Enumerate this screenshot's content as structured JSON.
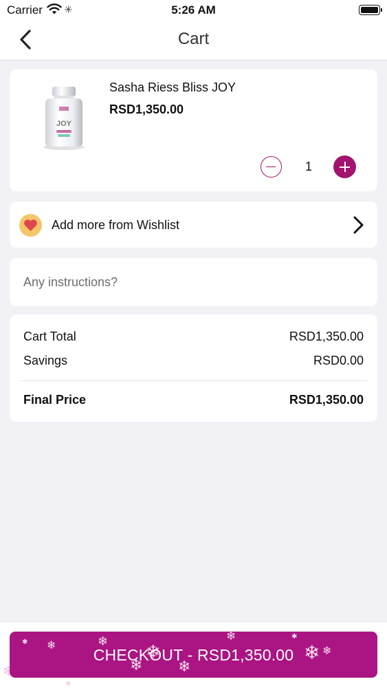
{
  "status_bar": {
    "carrier": "Carrier",
    "time": "5:26 AM",
    "icons": [
      "wifi-icon",
      "activity-spinner-icon",
      "battery-icon"
    ]
  },
  "navbar": {
    "title": "Cart",
    "back_icon": "chevron-left-icon"
  },
  "cart_item": {
    "name": "Sasha Riess Bliss JOY",
    "price": "RSD1,350.00",
    "quantity": "1",
    "image_label": "JOY"
  },
  "wishlist": {
    "label": "Add more from Wishlist",
    "icon": "heart-icon"
  },
  "instructions": {
    "placeholder": "Any instructions?",
    "value": ""
  },
  "summary": {
    "cart_total_label": "Cart Total",
    "cart_total_value": "RSD1,350.00",
    "savings_label": "Savings",
    "savings_value": "RSD0.00",
    "final_label": "Final Price",
    "final_value": "RSD1,350.00"
  },
  "checkout": {
    "label": "CHECKOUT - RSD1,350.00"
  },
  "colors": {
    "accent": "#a3146e",
    "checkout_bg": "#ab1583",
    "page_bg": "#f2f1f6",
    "heart_bg": "#f4c66a",
    "heart": "#e0464f"
  }
}
